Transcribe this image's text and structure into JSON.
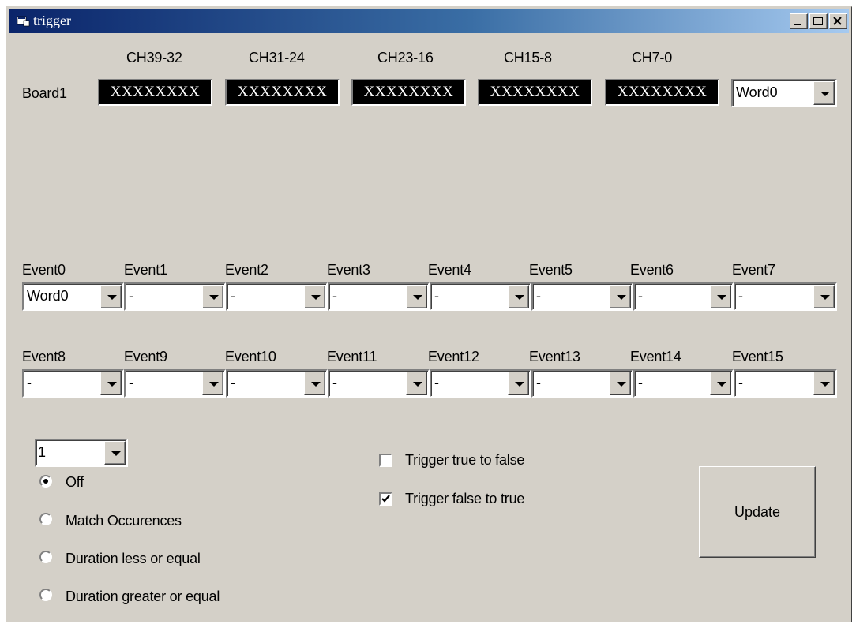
{
  "window": {
    "title": "trigger"
  },
  "channels": [
    "CH39-32",
    "CH31-24",
    "CH23-16",
    "CH15-8",
    "CH7-0"
  ],
  "board": {
    "label": "Board1",
    "values": [
      "XXXXXXXX",
      "XXXXXXXX",
      "XXXXXXXX",
      "XXXXXXXX",
      "XXXXXXXX"
    ],
    "word_select": "Word0"
  },
  "events_row1": [
    {
      "label": "Event0",
      "value": "Word0"
    },
    {
      "label": "Event1",
      "value": "-"
    },
    {
      "label": "Event2",
      "value": "-"
    },
    {
      "label": "Event3",
      "value": "-"
    },
    {
      "label": "Event4",
      "value": "-"
    },
    {
      "label": "Event5",
      "value": "-"
    },
    {
      "label": "Event6",
      "value": "-"
    },
    {
      "label": "Event7",
      "value": "-"
    }
  ],
  "events_row2": [
    {
      "label": "Event8",
      "value": "-"
    },
    {
      "label": "Event9",
      "value": "-"
    },
    {
      "label": "Event10",
      "value": "-"
    },
    {
      "label": "Event11",
      "value": "-"
    },
    {
      "label": "Event12",
      "value": "-"
    },
    {
      "label": "Event13",
      "value": "-"
    },
    {
      "label": "Event14",
      "value": "-"
    },
    {
      "label": "Event15",
      "value": "-"
    }
  ],
  "count_select": "1",
  "modes": [
    {
      "label": "Off",
      "selected": true
    },
    {
      "label": "Match Occurences",
      "selected": false
    },
    {
      "label": "Duration less or equal",
      "selected": false
    },
    {
      "label": "Duration greater or equal",
      "selected": false
    }
  ],
  "triggers": [
    {
      "label": "Trigger true to false",
      "checked": false
    },
    {
      "label": "Trigger false to true",
      "checked": true
    }
  ],
  "update_button": "Update"
}
